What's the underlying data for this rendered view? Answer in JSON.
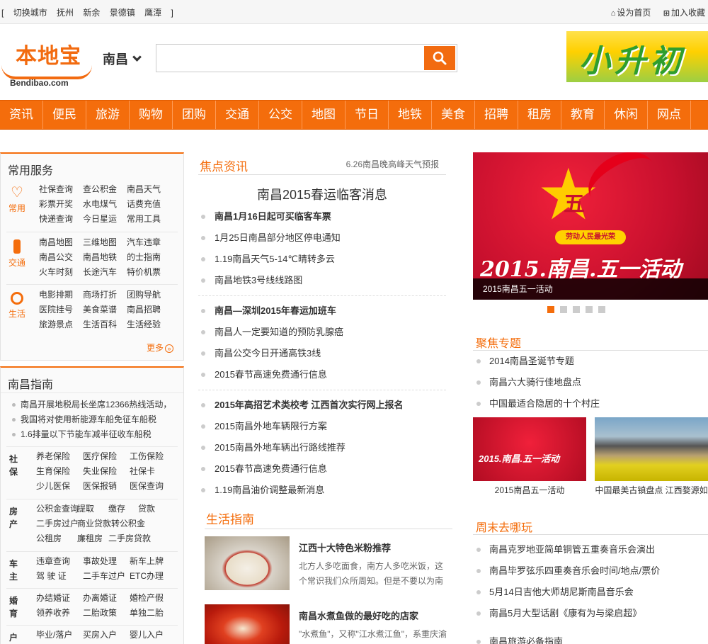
{
  "topbar": {
    "left_prefix": "[",
    "switch_city": "切换城市",
    "cities": [
      "抚州",
      "新余",
      "景德镇",
      "鹰潭"
    ],
    "left_suffix": "]",
    "set_home": "设为首页",
    "add_fav": "加入收藏"
  },
  "header": {
    "logo_cn": "本地宝",
    "logo_en": "Bendibao.com",
    "city": "南昌",
    "search_value": "",
    "ad_text": "小升初"
  },
  "nav": [
    "资讯",
    "便民",
    "旅游",
    "购物",
    "团购",
    "交通",
    "公交",
    "地图",
    "节日",
    "地铁",
    "美食",
    "招聘",
    "租房",
    "教育",
    "休闲",
    "网点"
  ],
  "services": {
    "title": "常用服务",
    "groups": [
      {
        "label": "常用",
        "icon": "heart-icon",
        "links": [
          "社保查询",
          "查公积金",
          "南昌天气",
          "彩票开奖",
          "水电煤气",
          "话费充值",
          "快递查询",
          "今日星运",
          "常用工具"
        ]
      },
      {
        "label": "交通",
        "icon": "traffic-light-icon",
        "links": [
          "南昌地图",
          "三维地图",
          "汽车违章",
          "南昌公交",
          "南昌地铁",
          "的士指南",
          "火车时刻",
          "长途汽车",
          "特价机票"
        ]
      },
      {
        "label": "生活",
        "icon": "circle-icon",
        "links": [
          "电影排期",
          "商场打折",
          "团购导航",
          "医院挂号",
          "美食菜谱",
          "南昌招聘",
          "旅游景点",
          "生活百科",
          "生活经验"
        ]
      }
    ],
    "more": "更多",
    "more_arrow": "»"
  },
  "guide": {
    "title": "南昌指南",
    "news": [
      "南昌开展地税局长坐席12366热线活动，",
      "我国将对使用新能源车船免征车船税",
      "1.6排量以下节能车减半征收车船税"
    ],
    "categories": [
      {
        "label": "社保",
        "links": [
          "养老保险",
          "医疗保险",
          "工伤保险",
          "生育保险",
          "失业保险",
          "社保卡",
          "少儿医保",
          "医保报销",
          "医保查询"
        ]
      },
      {
        "label": "房产",
        "links": [
          "公积金查询",
          "提取",
          "缴存",
          "贷款",
          "二手房过户",
          "商业贷款转公积金",
          "",
          "公租房",
          "廉租房",
          "二手房贷款"
        ]
      },
      {
        "label": "车主",
        "links": [
          "违章查询",
          "事故处理",
          "新车上牌",
          "驾 驶 证",
          "二手车过户",
          "ETC办理"
        ]
      },
      {
        "label": "婚育",
        "links": [
          "办结婚证",
          "办离婚证",
          "婚检产假",
          "领养收养",
          "二胎政策",
          "单独二胎"
        ]
      },
      {
        "label": "户口",
        "links": [
          "毕业/落户",
          "买房入户",
          "婴儿入户"
        ]
      }
    ]
  },
  "focus": {
    "title": "焦点资讯",
    "sub": "6.26南昌晚高峰天气预报",
    "headline": "南昌2015春运临客消息",
    "groups": [
      [
        {
          "t": "南昌1月16日起可买临客车票",
          "b": true
        },
        {
          "t": "1月25日南昌部分地区停电通知"
        },
        {
          "t": "1.19南昌天气5-14℃晴转多云"
        },
        {
          "t": "南昌地铁3号线线路图"
        }
      ],
      [
        {
          "t": "南昌—深圳2015年春运加班车",
          "b": true
        },
        {
          "t": "南昌人一定要知道的预防乳腺癌"
        },
        {
          "t": "南昌公交今日开通高铁3线"
        },
        {
          "t": "2015春节高速免费通行信息"
        }
      ],
      [
        {
          "t": "2015年高招艺术类校考 江西首次实行网上报名",
          "b": true
        },
        {
          "t": "2015南昌外地车辆限行方案"
        },
        {
          "t": "2015南昌外地车辆出行路线推荐"
        },
        {
          "t": "2015春节高速免费通行信息"
        },
        {
          "t": "1.19南昌油价调整最新消息"
        }
      ]
    ]
  },
  "life": {
    "title": "生活指南",
    "items": [
      {
        "title": "江西十大特色米粉推荐",
        "desc": "北方人多吃面食，南方人多吃米饭，这个常识我们众所周知。但是不要以为南"
      },
      {
        "title": "南昌水煮鱼做的最好吃的店家",
        "desc": "\"水煮鱼\"，又称\"江水煮江鱼\"，系重庆渝北风味，麻上头，辣过瘾，这样"
      }
    ]
  },
  "slider": {
    "star_char": "五",
    "badge": "劳动人民最光荣",
    "big_text": "2015.南昌.五一活动",
    "caption": "2015南昌五一活动",
    "dots": 5,
    "active": 0
  },
  "topics": {
    "title": "聚焦专题",
    "items": [
      "2014南昌圣诞节专题",
      "南昌六大骑行佳地盘点",
      "中国最适合隐居的十个村庄"
    ],
    "pics": [
      "2015南昌五一活动",
      "中国最美古镇盘点 江西婺源如"
    ]
  },
  "weekend": {
    "title": "周末去哪玩",
    "items": [
      "南昌克罗地亚简单铜管五重奏音乐会演出",
      "南昌毕罗弦乐四重奏音乐会时间/地点/票价",
      "5月14日吉他大师胡尼斯南昌音乐会",
      "南昌5月大型话剧《康有为与梁启超》",
      "南昌旅游必备指南"
    ]
  },
  "colors": {
    "accent": "#f46d0c"
  }
}
